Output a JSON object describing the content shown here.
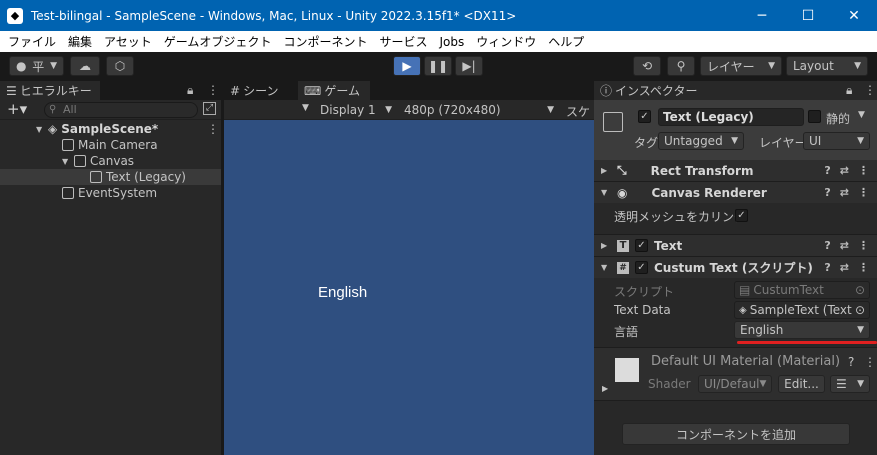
{
  "window": {
    "title": "Test-bilingal - SampleScene - Windows, Mac, Linux - Unity 2022.3.15f1* <DX11>",
    "logo": "unity-icon",
    "minimize": "─",
    "maximize": "☐",
    "close": "✕"
  },
  "menu": [
    "ファイル",
    "編集",
    "アセット",
    "ゲームオブジェクト",
    "コンポーネント",
    "サービス",
    "Jobs",
    "ウィンドウ",
    "ヘルプ"
  ],
  "toolbar": {
    "account_label": "平",
    "layer_label": "レイヤー",
    "layout_label": "Layout"
  },
  "hierarchy": {
    "tab_label": "ヒエラルキー",
    "search_placeholder": "All",
    "scene_name": "SampleScene*",
    "items": [
      "Main Camera",
      "Canvas",
      "Text (Legacy)",
      "EventSystem"
    ]
  },
  "scene_tab": {
    "label": "シーン"
  },
  "game": {
    "tab_label": "ゲーム",
    "display_label": "Display 1",
    "resolution_label": "480p (720x480)",
    "scale_label": "スケー",
    "game_text": "English",
    "background_color": "#2f4f80"
  },
  "inspector": {
    "tab_label": "インスペクター",
    "object_name": "Text (Legacy)",
    "static_label": "静的",
    "tag_label": "タグ",
    "tag_value": "Untagged",
    "layer_label": "レイヤー",
    "layer_value": "UI",
    "components": {
      "rect_transform": "Rect Transform",
      "canvas_renderer": "Canvas Renderer",
      "cull_transparent_label": "透明メッシュをカリング",
      "text": "Text",
      "custom_text": "Custum Text (スクリプト)"
    },
    "custom_text_fields": {
      "script_label": "スクリプト",
      "script_value": "CustumText",
      "text_data_label": "Text Data",
      "text_data_value": "SampleText (Text",
      "language_label": "言語",
      "language_value": "English"
    },
    "material": {
      "name": "Default UI Material (Material)",
      "shader_label": "Shader",
      "shader_value": "UI/Defaul",
      "edit_label": "Edit..."
    },
    "add_component_label": "コンポーネントを追加",
    "accent_underline_color": "#e02020"
  }
}
